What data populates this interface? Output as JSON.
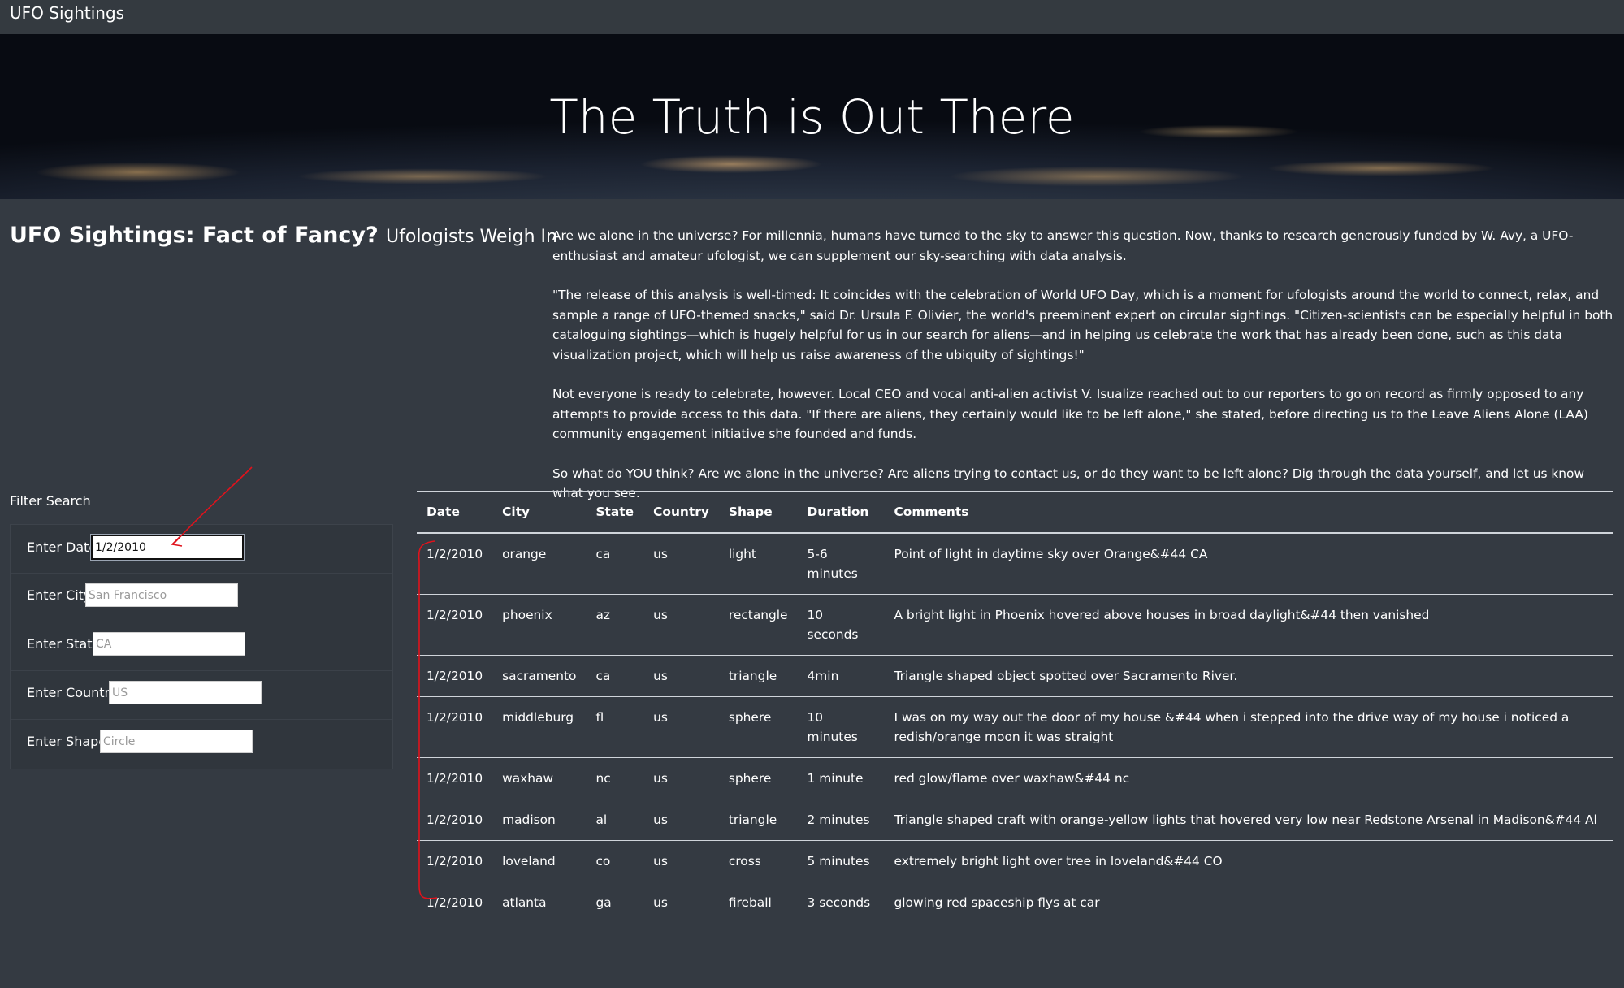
{
  "navbar": {
    "brand": "UFO Sightings"
  },
  "hero": {
    "title": "The Truth is Out There"
  },
  "heading": {
    "main": "UFO Sightings: Fact of Fancy?",
    "sub": "Ufologists Weigh In"
  },
  "intro": {
    "paragraphs": [
      "Are we alone in the universe? For millennia, humans have turned to the sky to answer this question. Now, thanks to research generously funded by W. Avy, a UFO-enthusiast and amateur ufologist, we can supplement our sky-searching with data analysis.",
      "\"The release of this analysis is well-timed: It coincides with the celebration of World UFO Day, which is a moment for ufologists around the world to connect, relax, and sample a range of UFO-themed snacks,\" said Dr. Ursula F. Olivier, the world's preeminent expert on circular sightings. \"Citizen-scientists can be especially helpful in both cataloguing sightings—which is hugely helpful for us in our search for aliens—and in helping us celebrate the work that has already been done, such as this data visualization project, which will help us raise awareness of the ubiquity of sightings!\"",
      "Not everyone is ready to celebrate, however. Local CEO and vocal anti-alien activist V. Isualize reached out to our reporters to go on record as firmly opposed to any attempts to provide access to this data. \"If there are aliens, they certainly would like to be left alone,\" she stated, before directing us to the Leave Aliens Alone (LAA) community engagement initiative she founded and funds.",
      "So what do YOU think? Are we alone in the universe? Are aliens trying to contact us, or do they want to be left alone? Dig through the data yourself, and let us know what you see."
    ]
  },
  "filters": {
    "title": "Filter Search",
    "date": {
      "label": "Enter Date",
      "value": "1/2/2010",
      "placeholder": ""
    },
    "city": {
      "label": "Enter City",
      "value": "",
      "placeholder": "San Francisco"
    },
    "state": {
      "label": "Enter State",
      "value": "",
      "placeholder": "CA"
    },
    "country": {
      "label": "Enter Country",
      "value": "",
      "placeholder": "US"
    },
    "shape": {
      "label": "Enter Shape",
      "value": "",
      "placeholder": "Circle"
    }
  },
  "table": {
    "headers": [
      "Date",
      "City",
      "State",
      "Country",
      "Shape",
      "Duration",
      "Comments"
    ],
    "rows": [
      [
        "1/2/2010",
        "orange",
        "ca",
        "us",
        "light",
        "5-6 minutes",
        "Point of light in daytime sky over Orange&#44 CA"
      ],
      [
        "1/2/2010",
        "phoenix",
        "az",
        "us",
        "rectangle",
        "10 seconds",
        "A bright light in Phoenix hovered above houses in broad daylight&#44 then vanished"
      ],
      [
        "1/2/2010",
        "sacramento",
        "ca",
        "us",
        "triangle",
        "4min",
        "Triangle shaped object spotted over Sacramento River."
      ],
      [
        "1/2/2010",
        "middleburg",
        "fl",
        "us",
        "sphere",
        "10 minutes",
        "I was on my way out the door of my house &#44 when i stepped into the drive way of my house i noticed a redish/orange moon it was straight"
      ],
      [
        "1/2/2010",
        "waxhaw",
        "nc",
        "us",
        "sphere",
        "1 minute",
        "red glow/flame over waxhaw&#44 nc"
      ],
      [
        "1/2/2010",
        "madison",
        "al",
        "us",
        "triangle",
        "2 minutes",
        "Triangle shaped craft with orange-yellow lights that hovered very low near Redstone Arsenal in Madison&#44 Al"
      ],
      [
        "1/2/2010",
        "loveland",
        "co",
        "us",
        "cross",
        "5 minutes",
        "extremely bright light over tree in loveland&#44 CO"
      ],
      [
        "1/2/2010",
        "atlanta",
        "ga",
        "us",
        "fireball",
        "3 seconds",
        "glowing red spaceship flys at car"
      ]
    ]
  },
  "colors": {
    "background": "#343a42",
    "annotation": "#e0121c"
  }
}
